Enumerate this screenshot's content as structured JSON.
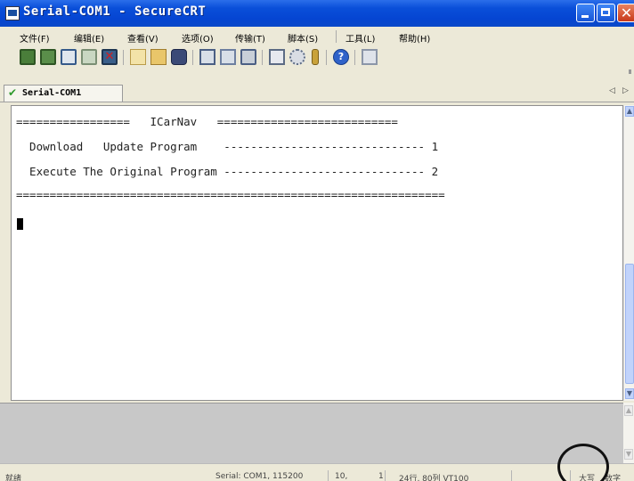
{
  "window": {
    "title": "Serial-COM1 - SecureCRT"
  },
  "menu": [
    {
      "label": "文件(F)"
    },
    {
      "label": "编辑(E)"
    },
    {
      "label": "查看(V)"
    },
    {
      "label": "选项(O)"
    },
    {
      "label": "传输(T)"
    },
    {
      "label": "脚本(S)"
    },
    {
      "label": "工具(L)"
    },
    {
      "label": "帮助(H)"
    }
  ],
  "toolbar": {
    "icons": [
      "connect-icon",
      "quick-connect-icon",
      "connect-in-tab-icon",
      "reconnect-icon",
      "disconnect-icon",
      "copy-icon",
      "paste-icon",
      "find-icon",
      "print-icon",
      "print-selection-icon",
      "printer-setup-icon",
      "session-options-icon",
      "global-options-icon",
      "key-icon",
      "help-icon",
      "map-icon"
    ]
  },
  "tabs": [
    {
      "label": "Serial-COM1",
      "status": "connected"
    }
  ],
  "terminal": {
    "lines": [
      "=================   ICarNav   ===========================",
      "  Download   Update Program    ------------------------------ 1",
      "  Execute The Original Program ------------------------------ 2",
      "================================================================"
    ]
  },
  "status": {
    "ready": "就绪",
    "connection": "Serial: COM1, 115200",
    "row": "10,",
    "col": "1",
    "size": "24行, 80列 VT100",
    "caps": "大写",
    "num": "数字"
  },
  "colors": {
    "titlebar": "#0A4FD9",
    "terminal_bg": "#FFFFFF",
    "chrome": "#ECE9D8",
    "scroll_thumb": "#C1D3FB"
  }
}
